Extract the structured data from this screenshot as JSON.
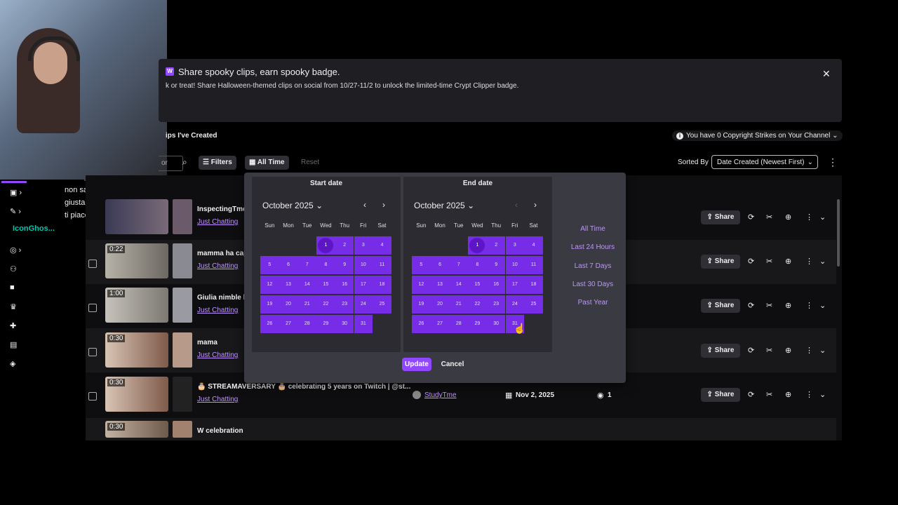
{
  "banner": {
    "badge": "W",
    "title": "Share spooky clips, earn spooky badge.",
    "text": "k or treat! Share Halloween-themed clips on social from 10/27-11/2 to unlock the limited-time Crypt Clipper badge."
  },
  "section": {
    "title": "ips I've Created",
    "strikes": "You have 0 Copyright Strikes on Your Channel"
  },
  "toolbar": {
    "search_partial": "or",
    "filters": "Filters",
    "all_time": "All Time",
    "reset": "Reset",
    "sorted_by": "Sorted By",
    "sort_value": "Date Created (Newest First)"
  },
  "picker": {
    "start_label": "Start date",
    "end_label": "End date",
    "start_month": "October 2025",
    "end_month": "October 2025",
    "weekdays": [
      "Sun",
      "Mon",
      "Tue",
      "Wed",
      "Thu",
      "Fri",
      "Sat"
    ],
    "days": [
      "1",
      "2",
      "3",
      "4",
      "5",
      "6",
      "7",
      "8",
      "9",
      "10",
      "11",
      "12",
      "13",
      "14",
      "15",
      "16",
      "17",
      "18",
      "19",
      "20",
      "21",
      "22",
      "23",
      "24",
      "25",
      "26",
      "27",
      "28",
      "29",
      "30",
      "31"
    ],
    "presets": [
      "All Time",
      "Last 24 Hours",
      "Last 7 Days",
      "Last 30 Days",
      "Past Year"
    ],
    "update": "Update",
    "cancel": "Cancel"
  },
  "clips": [
    {
      "duration": "",
      "title": "InspectingTme",
      "category": "Just Chatting"
    },
    {
      "duration": "0:22",
      "title": "mamma ha cap",
      "category": "Just Chatting"
    },
    {
      "duration": "1:00",
      "title": "Giulia nimble li",
      "category": "Just Chatting"
    },
    {
      "duration": "0:30",
      "title": "mama",
      "category": "Just Chatting"
    },
    {
      "duration": "0:30",
      "title": "🎂 STREAMAVERSARY 🎂 celebrating 5 years on Twitch | @st...",
      "category": "Just Chatting",
      "creator": "StudyTme",
      "date": "Nov 2, 2025",
      "views": "1"
    },
    {
      "duration": "0:30",
      "title": "W celebration",
      "category": "",
      "creator": "",
      "date": "",
      "views": ""
    }
  ],
  "row_actions": {
    "share": "Share"
  },
  "chat": {
    "lines": [
      "non sapere se era la strada",
      "giusta e se quello che facevi",
      "ti piaceva?"
    ],
    "user": "IconGhos..."
  },
  "colors": {
    "accent": "#9147ff",
    "day_bg": "#772ce8",
    "selected": "#5c16c5",
    "link": "#bf94ff"
  }
}
